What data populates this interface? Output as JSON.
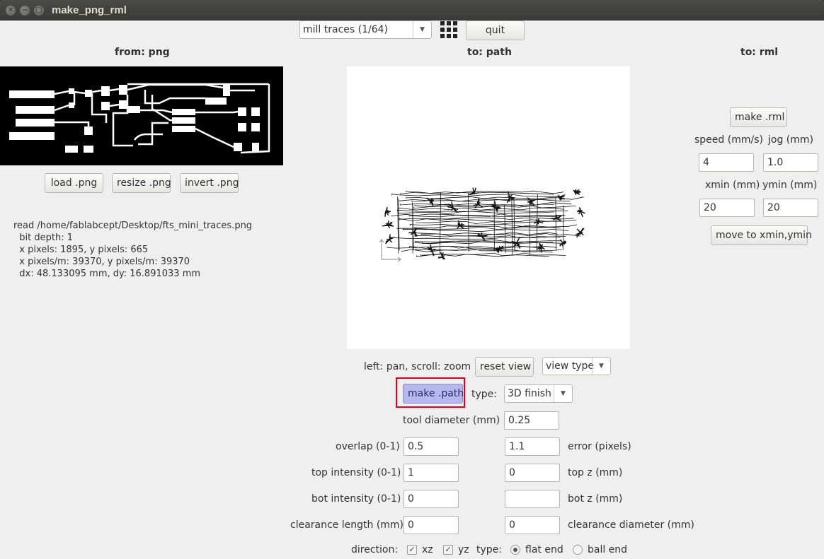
{
  "window": {
    "title": "make_png_rml"
  },
  "toolbar": {
    "process_selected": "mill traces (1/64)",
    "grid_icon": "grid-icon",
    "quit_label": "quit"
  },
  "png_panel": {
    "heading": "from: png",
    "buttons": {
      "load": "load .png",
      "resize": "resize .png",
      "invert": "invert .png"
    },
    "info_lines": [
      "read /home/fablabcept/Desktop/fts_mini_traces.png",
      "  bit depth: 1",
      "  x pixels: 1895, y pixels: 665",
      "  x pixels/m: 39370, y pixels/m: 39370",
      "  dx: 48.133095 mm, dy: 16.891033 mm"
    ]
  },
  "path_panel": {
    "heading": "to: path",
    "view_hint": "left: pan, scroll: zoom",
    "reset_view": "reset view",
    "view_type": "view type",
    "make_path": "make .path",
    "type_label": "type:",
    "type_selected": "3D finish",
    "tool_diameter_label": "tool diameter (mm)",
    "tool_diameter": "0.25",
    "overlap_label": "overlap (0-1)",
    "overlap": "0.5",
    "error_label": "error (pixels)",
    "error": "1.1",
    "top_intensity_label": "top intensity (0-1)",
    "top_intensity": "1",
    "top_z_label": "top z (mm)",
    "top_z": "0",
    "bot_intensity_label": "bot intensity (0-1)",
    "bot_intensity": "0",
    "bot_z_label": "bot z (mm)",
    "bot_z": "",
    "clearance_length_label": "clearance length (mm)",
    "clearance_length": "0",
    "clearance_diameter_label": "clearance diameter (mm)",
    "clearance_diameter": "0",
    "direction_label": "direction:",
    "dir_xz_label": "xz",
    "dir_xz_checked": true,
    "dir_yz_label": "yz",
    "dir_yz_checked": true,
    "tool_type_label": "type:",
    "flat_end_label": "flat end",
    "flat_end_selected": true,
    "ball_end_label": "ball end",
    "ball_end_selected": false,
    "highlight_color": "#e0001b",
    "make_path_fill": "#b7b8f0"
  },
  "rml_panel": {
    "heading": "to: rml",
    "make_rml": "make .rml",
    "speed_label": "speed (mm/s)",
    "speed": "4",
    "jog_label": "jog (mm)",
    "jog": "1.0",
    "xmin_label": "xmin (mm)",
    "xmin": "20",
    "ymin_label": "ymin (mm)",
    "ymin": "20",
    "move_button": "move to xmin,ymin"
  }
}
